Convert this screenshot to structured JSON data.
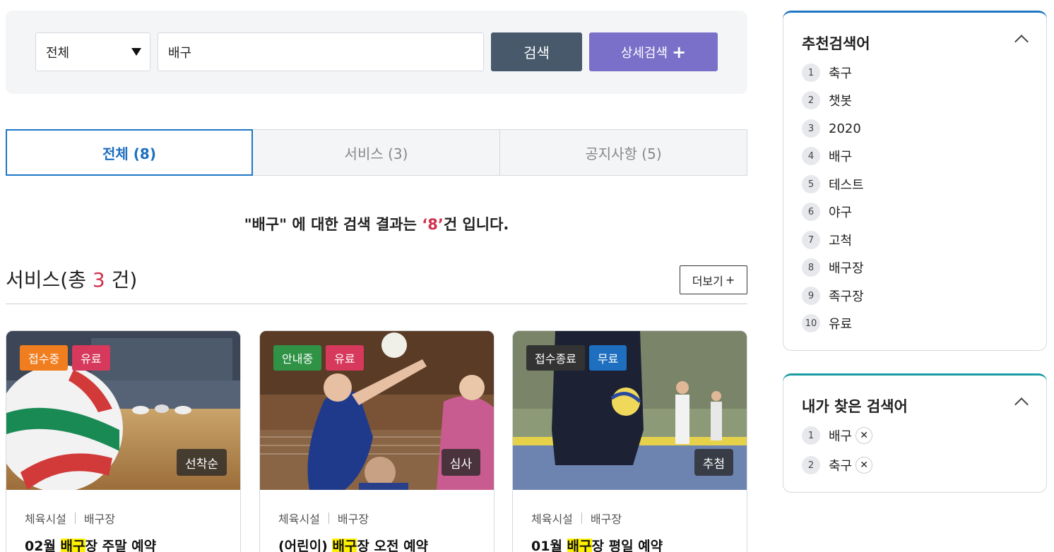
{
  "search": {
    "category": "전체",
    "query": "배구",
    "search_label": "검색",
    "detail_label": "상세검색",
    "detail_plus": "+"
  },
  "tabs": [
    {
      "label": "전체 (8)"
    },
    {
      "label": "서비스 (3)"
    },
    {
      "label": "공지사항 (5)"
    }
  ],
  "result": {
    "query_quoted": "\"배구\"",
    "text_a": " 에 대한 검색 결과는 ",
    "count": "‘8’",
    "text_b": "건 입니다."
  },
  "section": {
    "title_prefix": "서비스(총 ",
    "count": "3",
    "title_suffix": " 건)",
    "more_label": "더보기",
    "more_plus": "+"
  },
  "cards": [
    {
      "status": "접수중",
      "status_color": "#f07e1f",
      "fee": "유료",
      "fee_color": "#d6395b",
      "order": "선착순",
      "category": "체육시설",
      "subcategory": "배구장",
      "title_pre": "02월 ",
      "title_hl": "배구",
      "title_post": "장 주말 예약"
    },
    {
      "status": "안내중",
      "status_color": "#2f9245",
      "fee": "유료",
      "fee_color": "#d6395b",
      "order": "심사",
      "category": "체육시설",
      "subcategory": "배구장",
      "title_pre": "(어린이) ",
      "title_hl": "배구",
      "title_post": "장 오전 예약"
    },
    {
      "status": "접수종료",
      "status_color": "#333333",
      "fee": "무료",
      "fee_color": "#1e6fc0",
      "order": "추첨",
      "category": "체육시설",
      "subcategory": "배구장",
      "title_pre": "01월 ",
      "title_hl": "배구",
      "title_post": "장 평일 예약"
    }
  ],
  "recommended": {
    "title": "추천검색어",
    "items": [
      {
        "n": "1",
        "label": "축구"
      },
      {
        "n": "2",
        "label": "챗봇"
      },
      {
        "n": "3",
        "label": "2020"
      },
      {
        "n": "4",
        "label": "배구"
      },
      {
        "n": "5",
        "label": "테스트"
      },
      {
        "n": "6",
        "label": "야구"
      },
      {
        "n": "7",
        "label": "고척"
      },
      {
        "n": "8",
        "label": "배구장"
      },
      {
        "n": "9",
        "label": "족구장"
      },
      {
        "n": "10",
        "label": "유료"
      }
    ]
  },
  "my_searches": {
    "title": "내가 찾은 검색어",
    "items": [
      {
        "n": "1",
        "label": "배구"
      },
      {
        "n": "2",
        "label": "축구"
      }
    ],
    "remove_glyph": "✕"
  },
  "colors": {
    "accent_blue": "#1e77c6",
    "search_button": "#48596b",
    "detail_button": "#7b70c9",
    "count_red": "#d0314d",
    "highlight": "#fff200",
    "panel_teal": "#1a9ca4"
  }
}
